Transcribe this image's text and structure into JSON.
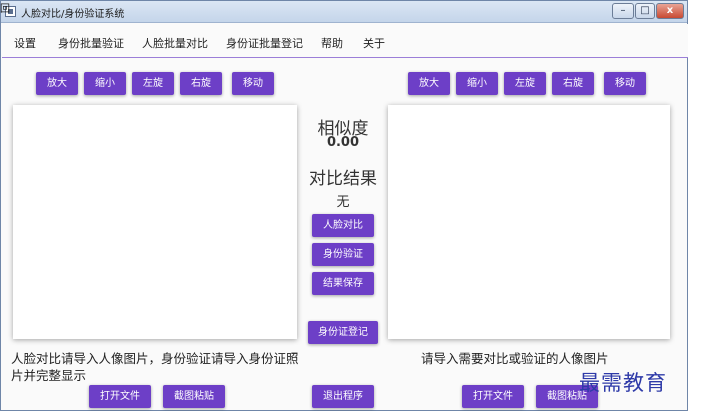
{
  "window": {
    "title": "人脸对比/身份验证系统",
    "minimize": "–",
    "maximize": "□",
    "close": "x"
  },
  "menu": [
    "设置",
    "身份批量验证",
    "人脸批量对比",
    "身份证批量登记",
    "帮助",
    "关于"
  ],
  "left_toolbar": [
    "放大",
    "缩小",
    "左旋",
    "右旋",
    "移动"
  ],
  "right_toolbar": [
    "放大",
    "缩小",
    "左旋",
    "右旋",
    "移动"
  ],
  "center": {
    "similarity_label": "相似度",
    "similarity_value": "0.00",
    "result_label": "对比结果",
    "result_value": "无",
    "face_compare_button": "人脸对比",
    "identity_verify_button": "身份验证",
    "save_result_button": "结果保存",
    "id_register_button": "身份证登记",
    "exit_button": "退出程序"
  },
  "left_hint": "人脸对比请导入人像图片，身份验证请导入身份证照片并完整显示",
  "right_hint": "请导入需要对比或验证的人像图片",
  "left_bottom": {
    "open_file": "打开文件",
    "paste_screenshot": "截图粘贴"
  },
  "right_bottom": {
    "open_file": "打开文件",
    "paste_screenshot": "截图粘贴"
  },
  "watermark": "最需教育",
  "corner_mark": "回"
}
